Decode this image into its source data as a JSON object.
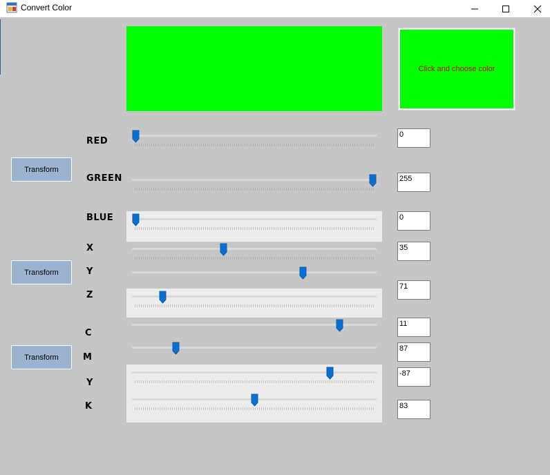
{
  "window": {
    "title": "Convert Color",
    "icon": "app-window-icon",
    "controls": [
      "minimize-icon",
      "maximize-icon",
      "close-icon"
    ]
  },
  "preview": {
    "color": "#00ff00"
  },
  "chooser": {
    "label": "Click and choose color",
    "color": "#00ff00",
    "text_color": "#d80000"
  },
  "transform_buttons": {
    "label": "Transform",
    "color": "#9ab4d0"
  },
  "sliders": {
    "max": 255,
    "red": {
      "label": "RED",
      "value": "0"
    },
    "green": {
      "label": "GREEN",
      "value": "255"
    },
    "blue": {
      "label": "BLUE",
      "value": "0"
    },
    "x": {
      "label": "X",
      "value": "35"
    },
    "y": {
      "label": "Y",
      "value": "71"
    },
    "z": {
      "label": "Z",
      "value": ""
    },
    "c": {
      "label": "C",
      "value": "11"
    },
    "m": {
      "label": "M",
      "value": "87"
    },
    "yc": {
      "label": "Y",
      "value": "-87"
    },
    "k": {
      "label": "K",
      "value": "83"
    }
  },
  "colors": {
    "thumb": "#0a6fd1",
    "background": "#c6c6c6"
  }
}
